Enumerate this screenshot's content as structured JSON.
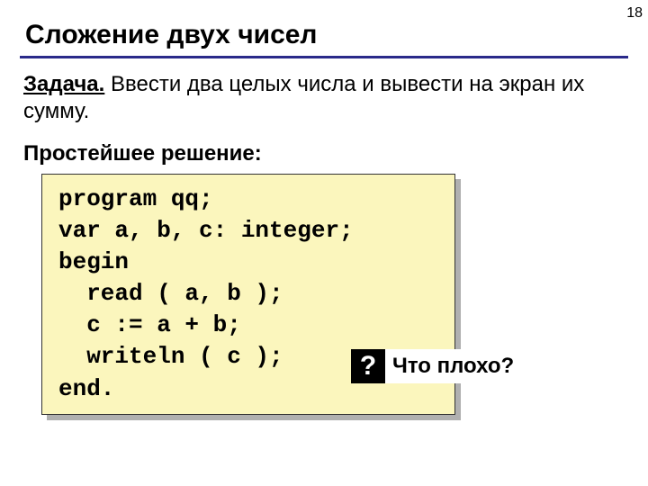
{
  "page_number": "18",
  "title": "Сложение двух чисел",
  "task_label": "Задача.",
  "task_text": " Ввести два целых числа и вывести на экран их сумму.",
  "solution_label": "Простейшее решение:",
  "code": {
    "l1": "program qq;",
    "l2": "var a, b, c: integer;",
    "l3": "begin",
    "l4": "  read ( a, b );",
    "l5": "  c := a + b;",
    "l6": "  writeln ( c );",
    "l7": "end."
  },
  "callout": {
    "badge": "?",
    "text": "Что плохо?"
  }
}
